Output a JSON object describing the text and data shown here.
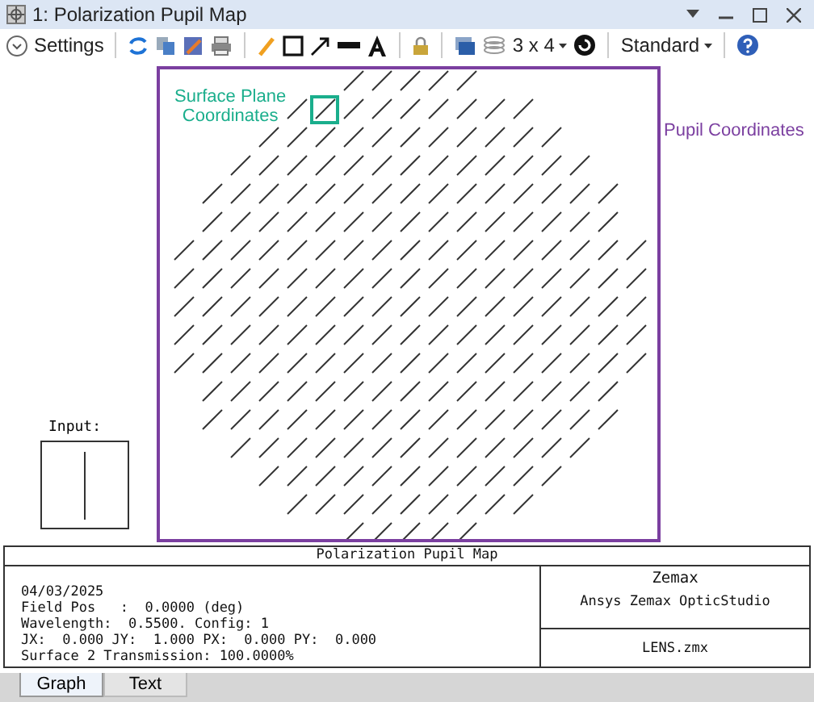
{
  "window": {
    "title": "1: Polarization Pupil Map"
  },
  "toolbar": {
    "settings": "Settings",
    "layout": "3 x 4",
    "style": "Standard"
  },
  "plot": {
    "surface_label": "Surface Plane\nCoordinates",
    "pupil_label": "Pupil Coordinates",
    "input_label": "Input:"
  },
  "info": {
    "title": "Polarization Pupil Map",
    "lines": [
      "04/03/2025",
      "Field Pos   :  0.0000 (deg)",
      "Wavelength:  0.5500. Config: 1",
      "JX:  0.000 JY:  1.000 PX:  0.000 PY:  0.000",
      "Surface 2 Transmission: 100.0000%"
    ],
    "company": "Zemax",
    "product": "Ansys Zemax OpticStudio",
    "file": "LENS.zmx"
  },
  "tabs": [
    {
      "label": "Graph",
      "selected": true
    },
    {
      "label": "Text",
      "selected": false
    }
  ]
}
